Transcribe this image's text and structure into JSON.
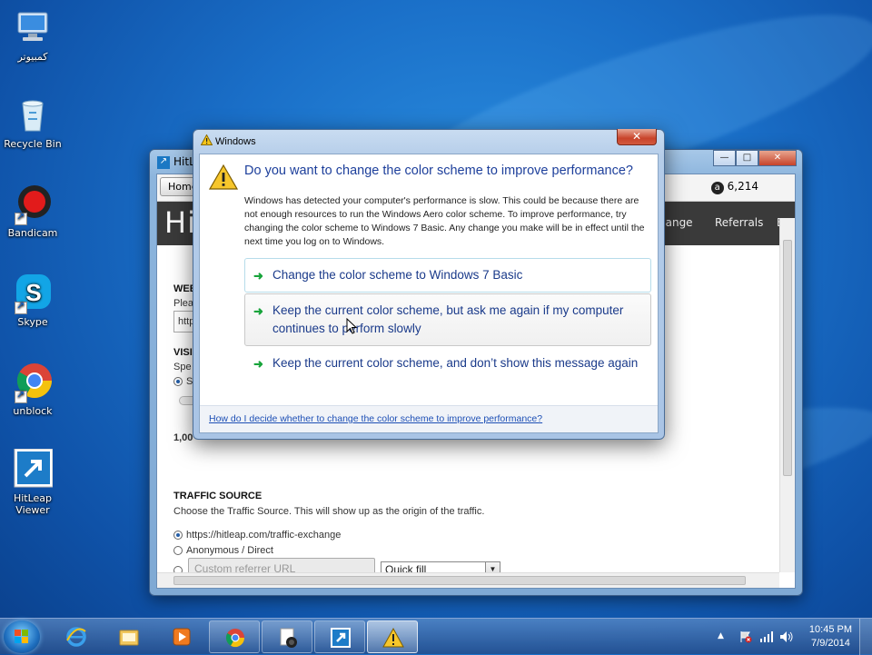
{
  "desktop": {
    "icons": [
      {
        "label": "كمبيوتر"
      },
      {
        "label": "Recycle Bin"
      },
      {
        "label": "Bandicam"
      },
      {
        "label": "Skype"
      },
      {
        "label": "unblock"
      },
      {
        "label": "HitLeap\nViewer"
      }
    ]
  },
  "hitleap": {
    "title": "HitLe",
    "home_label": "Home",
    "credits": "6,214",
    "brand": "Hi",
    "nav": [
      "hange",
      "Referrals",
      "E"
    ],
    "sections": {
      "website_head": "WEE",
      "website_sub": "Plea",
      "url_value": "http",
      "visit_head": "VISI",
      "visit_sub": "Spe",
      "visit_radio": "S",
      "minutes_text": "1,00",
      "traffic_head": "TRAFFIC SOURCE",
      "traffic_desc": "Choose the Traffic Source. This will show up as the origin of the traffic.",
      "radio_1": "https://hitleap.com/traffic-exchange",
      "radio_2": "Anonymous / Direct",
      "custom_placeholder": "Custom referrer URL",
      "quickfill": "Quick fill"
    }
  },
  "dialog": {
    "title": "Windows",
    "close": "✕",
    "question": "Do you want to change the color scheme to improve performance?",
    "description": "Windows has detected your computer's performance is slow. This could be because there are not enough resources to run the Windows Aero color scheme. To improve performance, try changing the color scheme to Windows 7 Basic. Any change you make will be in effect until the next time you log on to Windows.",
    "options": [
      {
        "label": "Change the color scheme to Windows 7 Basic"
      },
      {
        "label": "Keep the current color scheme, but ask me again if my computer continues to perform slowly"
      },
      {
        "label": "Keep the current color scheme, and don’t show this message again"
      }
    ],
    "help_link": "How do I decide whether to change the color scheme to improve performance?"
  },
  "taskbar": {
    "time": "10:45 PM",
    "date": "7/9/2014"
  },
  "colors": {
    "accent": "#1d3f9b",
    "arrow": "#18a43b"
  }
}
